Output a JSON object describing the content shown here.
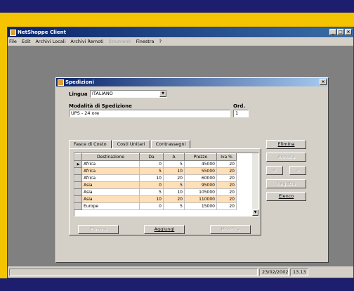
{
  "app": {
    "title": "NetShoppe Client",
    "menu": [
      {
        "label": "File",
        "disabled": false
      },
      {
        "label": "Edit",
        "disabled": false
      },
      {
        "label": "Archivi Locali",
        "disabled": false
      },
      {
        "label": "Archivi Remoti",
        "disabled": false
      },
      {
        "label": "Strumenti",
        "disabled": true
      },
      {
        "label": "Finestra",
        "disabled": false
      },
      {
        "label": "?",
        "disabled": false
      }
    ],
    "window_buttons": {
      "minimize": "_",
      "maximize": "□",
      "close": "×"
    }
  },
  "dialog": {
    "title": "Spedizioni",
    "close": "×",
    "lingua_label": "Lingua",
    "lingua_value": "ITALIANO",
    "modalita_label": "Modalità di Spedizione",
    "modalita_value": "UPS - 24 ore",
    "ord_label": "Ord.",
    "ord_value": "1",
    "tabs": [
      "Fasce di Costo",
      "Costi Unitari",
      "Contrassegni"
    ],
    "table": {
      "columns": [
        "Destinazione",
        "Da",
        "A",
        "Prezzo",
        "Iva %"
      ],
      "rows": [
        [
          "Africa",
          "0",
          "5",
          "45000",
          "20"
        ],
        [
          "Africa",
          "5",
          "10",
          "55000",
          "20"
        ],
        [
          "Africa",
          "10",
          "20",
          "60000",
          "20"
        ],
        [
          "Asia",
          "0",
          "5",
          "95000",
          "20"
        ],
        [
          "Asia",
          "5",
          "10",
          "105000",
          "20"
        ],
        [
          "Asia",
          "10",
          "20",
          "110000",
          "20"
        ],
        [
          "Europe",
          "0",
          "5",
          "15000",
          "20"
        ]
      ]
    },
    "buttons": {
      "elimina_row": "Elimina",
      "aggiungi": "Aggiungi",
      "modifica": "Modifica",
      "elimina": "Elimina",
      "annulla": "Annulla",
      "prev": "<",
      "next": ">",
      "registra": "Registra",
      "elenco": "Elenco"
    }
  },
  "status": {
    "date": "23/02/2002",
    "time": "13.13"
  },
  "colors": {
    "frame": "#f5c400",
    "band": "#1e1e6e",
    "row_highlight": "#ffdfb8"
  }
}
